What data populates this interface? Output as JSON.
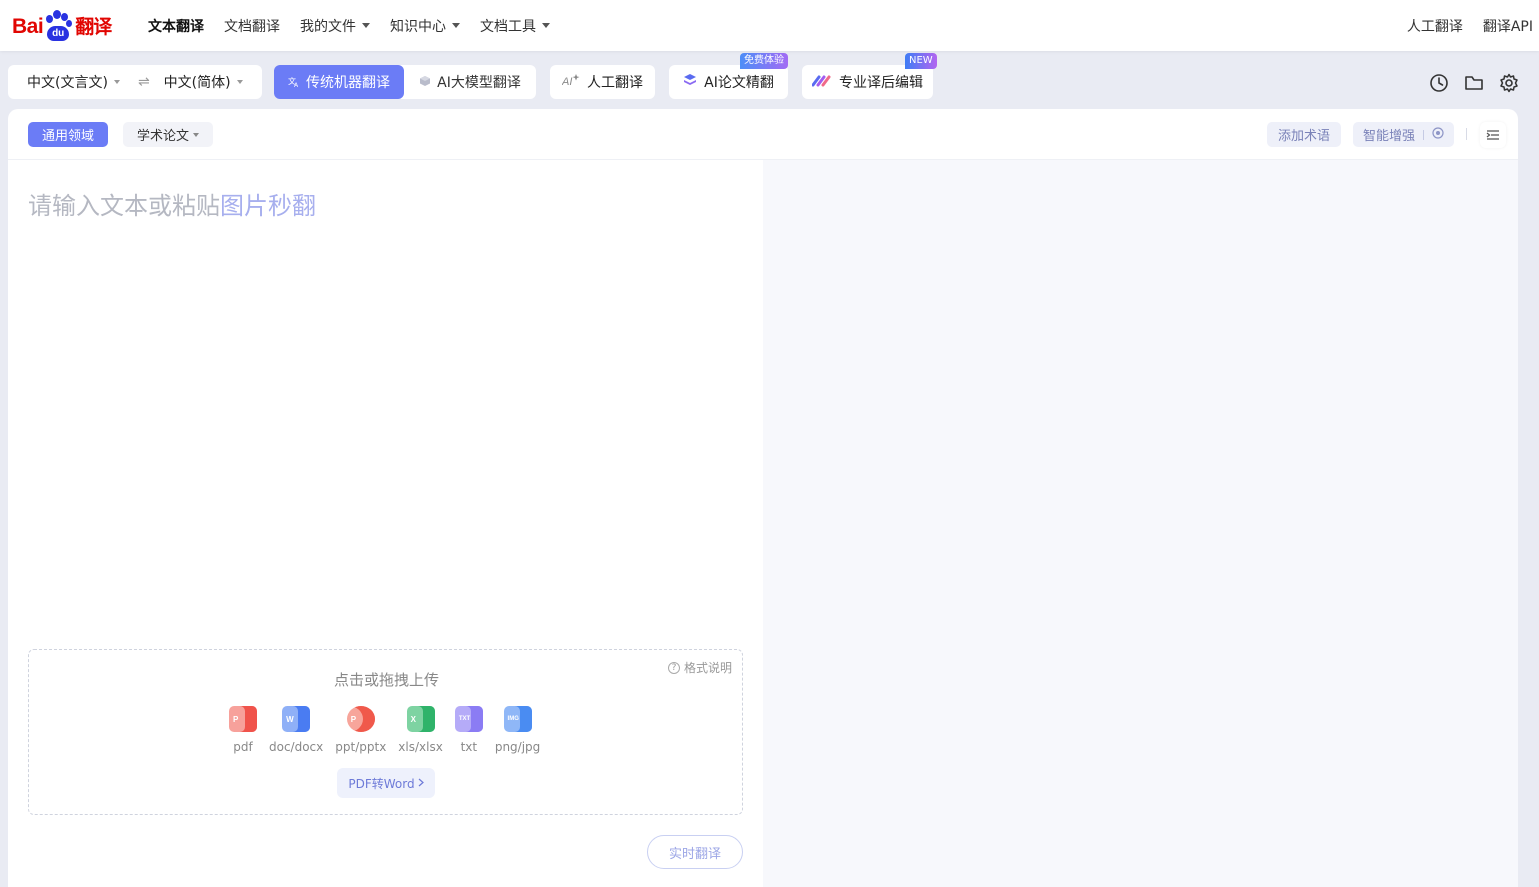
{
  "logo": {
    "left": "Bai",
    "paw": "du",
    "right": "翻译"
  },
  "nav": {
    "links": [
      {
        "label": "文本翻译",
        "active": true,
        "dropdown": false
      },
      {
        "label": "文档翻译",
        "active": false,
        "dropdown": false
      },
      {
        "label": "我的文件",
        "active": false,
        "dropdown": true
      },
      {
        "label": "知识中心",
        "active": false,
        "dropdown": true
      },
      {
        "label": "文档工具",
        "active": false,
        "dropdown": true
      }
    ],
    "right": [
      "人工翻译",
      "翻译API"
    ]
  },
  "toolbar": {
    "source_lang": "中文(文言文)",
    "swap_icon": "⇌",
    "target_lang": "中文(简体)",
    "modes": [
      "传统机器翻译",
      "AI大模型翻译"
    ],
    "human_translate": "人工翻译",
    "ai_paper": "AI论文精翻",
    "ai_paper_badge": "免费体验",
    "post_edit": "专业译后编辑",
    "post_edit_badge": "NEW",
    "icons": [
      "history-icon",
      "folder-icon",
      "settings-icon"
    ]
  },
  "panel": {
    "domain_general": "通用领域",
    "domain_academic": "学术论文",
    "add_terms": "添加术语",
    "smart_enhance": "智能增强",
    "placeholder_text": "请输入文本或粘贴",
    "placeholder_highlight": "图片秒翻",
    "upload_title": "点击或拖拽上传",
    "format_help": "格式说明",
    "file_types": [
      {
        "label": "pdf",
        "tag": "P",
        "color": "#f0534b"
      },
      {
        "label": "doc/docx",
        "tag": "W",
        "color": "#4a7cf2"
      },
      {
        "label": "ppt/pptx",
        "tag": "P",
        "color": "#f0594b"
      },
      {
        "label": "xls/xlsx",
        "tag": "X",
        "color": "#2fb36a"
      },
      {
        "label": "txt",
        "tag": "TXT",
        "color": "#8b7cf4"
      },
      {
        "label": "png/jpg",
        "tag": "IMG",
        "color": "#4a8cf2"
      }
    ],
    "pdf_to_word": "PDF转Word",
    "realtime_translate": "实时翻译"
  }
}
